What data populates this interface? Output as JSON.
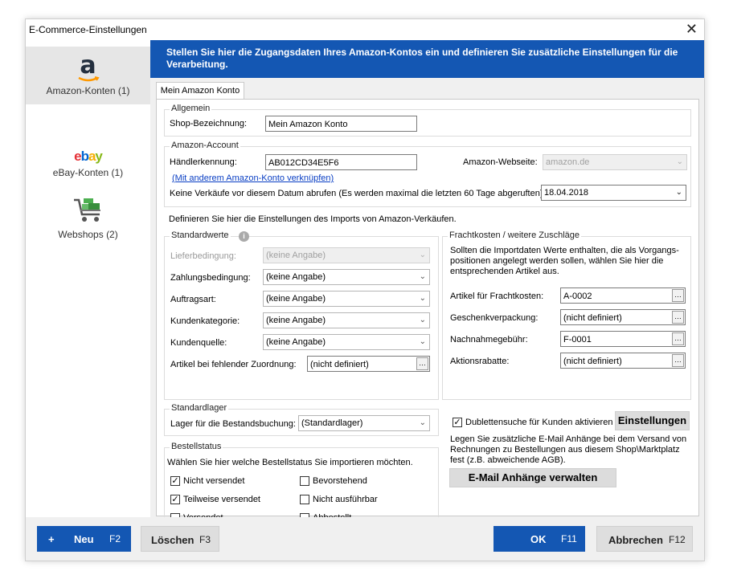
{
  "window": {
    "title": "E-Commerce-Einstellungen",
    "close_glyph": "✕"
  },
  "sidebar": {
    "items": [
      {
        "label": "Amazon-Konten (1)",
        "icon": "amazon-logo-icon",
        "glyph": "a"
      },
      {
        "label": "eBay-Konten (1)",
        "icon": "ebay-logo-icon",
        "glyph": "ebay"
      },
      {
        "label": "Webshops (2)",
        "icon": "shopping-cart-icon"
      }
    ]
  },
  "header": {
    "text": "Stellen Sie hier die Zugangsdaten Ihres Amazon-Kontos ein und definieren Sie zusätzliche Einstellungen für die Verarbeitung."
  },
  "tab": {
    "label": "Mein Amazon Konto"
  },
  "allgemein": {
    "title": "Allgemein",
    "shop_label": "Shop-Bezeichnung:",
    "shop_value": "Mein Amazon Konto"
  },
  "amazon_account": {
    "title": "Amazon-Account",
    "haendler_label": "Händlerkennung:",
    "haendler_value": "AB012CD34E5F6",
    "webseite_label": "Amazon-Webseite:",
    "webseite_value": "amazon.de",
    "link_text": "(Mit anderem Amazon-Konto verknüpfen)",
    "datum_label": "Keine Verkäufe vor diesem Datum abrufen (Es werden maximal die letzten 60 Tage abgeruften):",
    "datum_value": "18.04.2018"
  },
  "import_text": "Definieren Sie hier die Einstellungen des Imports von Amazon-Verkäufen.",
  "standardwerte": {
    "title": "Standardwerte",
    "info_glyph": "i",
    "rows": [
      {
        "label": "Lieferbedingung:",
        "value": "(keine Angabe)",
        "disabled": true
      },
      {
        "label": "Zahlungsbedingung:",
        "value": "(keine Angabe)",
        "disabled": false
      },
      {
        "label": "Auftragsart:",
        "value": "(keine Angabe)",
        "disabled": false
      },
      {
        "label": "Kundenkategorie:",
        "value": "(keine Angabe)",
        "disabled": false
      },
      {
        "label": "Kundenquelle:",
        "value": "(keine Angabe)",
        "disabled": false
      }
    ],
    "artikel_label": "Artikel bei fehlender Zuordnung:",
    "artikel_value": "(nicht definiert)"
  },
  "frachtkosten": {
    "title": "Frachtkosten / weitere Zuschläge",
    "description": "Sollten die Importdaten Werte enthalten, die als Vorgangs-positionen angelegt werden sollen, wählen Sie hier die entsprechenden Artikel aus.",
    "rows": [
      {
        "label": "Artikel für Frachtkosten:",
        "value": "A-0002"
      },
      {
        "label": "Geschenkverpackung:",
        "value": "(nicht definiert)"
      },
      {
        "label": "Nachnahmegebühr:",
        "value": "F-0001"
      },
      {
        "label": "Aktionsrabatte:",
        "value": "(nicht definiert)"
      }
    ]
  },
  "standardlager": {
    "title": "Standardlager",
    "label": "Lager für die Bestandsbuchung:",
    "value": "(Standardlager)"
  },
  "bestellstatus": {
    "title": "Bestellstatus",
    "description": "Wählen Sie hier welche Bestellstatus Sie importieren möchten.",
    "items": [
      {
        "label": "Nicht versendet",
        "checked": true
      },
      {
        "label": "Bevorstehend",
        "checked": false
      },
      {
        "label": "Teilweise versendet",
        "checked": true
      },
      {
        "label": "Nicht ausführbar",
        "checked": false
      },
      {
        "label": "Versendet",
        "checked": false
      },
      {
        "label": "Abbestellt",
        "checked": false
      }
    ]
  },
  "dubletten": {
    "label": "Dublettensuche für Kunden aktivieren",
    "checked": true,
    "button": "Einstellungen"
  },
  "email": {
    "description": "Legen Sie zusätzliche E-Mail Anhänge bei dem Versand von Rechnungen zu Bestellungen aus diesem Shop\\Marktplatz fest (z.B. abweichende AGB).",
    "button": "E-Mail Anhänge verwalten"
  },
  "footer": {
    "neu": {
      "plus": "+",
      "label": "Neu",
      "key": "F2"
    },
    "loeschen": {
      "label": "Löschen",
      "key": "F3"
    },
    "ok": {
      "label": "OK",
      "key": "F11"
    },
    "abbrechen": {
      "label": "Abbrechen",
      "key": "F12"
    }
  },
  "colors": {
    "accent": "#1457b3",
    "link": "#0a3fc4"
  },
  "glyphs": {
    "chevron": "⌄",
    "dots": "…",
    "check": "✓"
  }
}
